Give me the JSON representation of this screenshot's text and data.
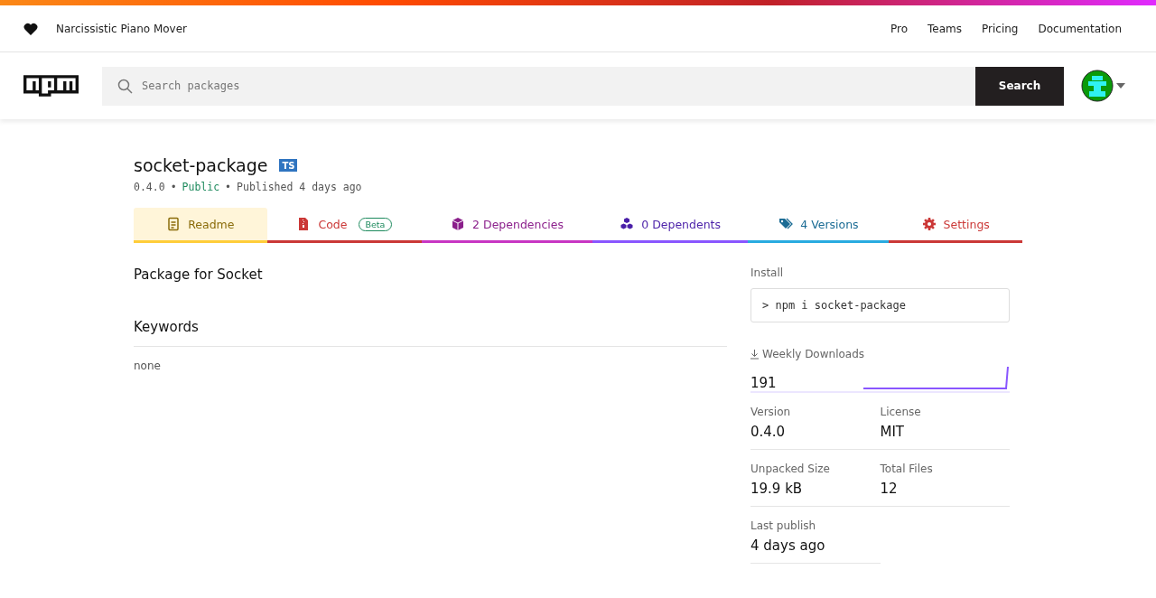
{
  "header": {
    "tagline": "Narcissistic Piano Mover",
    "links": [
      "Pro",
      "Teams",
      "Pricing",
      "Documentation"
    ]
  },
  "search": {
    "placeholder": "Search packages",
    "button": "Search"
  },
  "package": {
    "name": "socket-package",
    "ts_badge": "TS",
    "version": "0.4.0",
    "visibility": "Public",
    "published": "Published 4 days ago",
    "separator": "•"
  },
  "tabs": [
    {
      "kind": "readme",
      "label": "Readme",
      "selected": true,
      "color": "#8a6c0a"
    },
    {
      "kind": "code",
      "label": "Code",
      "badge": "Beta",
      "selected": false,
      "color": "#cb3837"
    },
    {
      "kind": "dependencies",
      "label": "2 Dependencies",
      "selected": false,
      "color": "#8b1f8b"
    },
    {
      "kind": "dependents",
      "label": "0 Dependents",
      "selected": false,
      "color": "#4a1fa8"
    },
    {
      "kind": "versions",
      "label": "4 Versions",
      "selected": false,
      "color": "#1a6b94"
    },
    {
      "kind": "settings",
      "label": "Settings",
      "selected": false,
      "color": "#cb3837"
    }
  ],
  "readme": {
    "description": "Package for Socket",
    "keywords_title": "Keywords",
    "keywords": "none"
  },
  "sidebar": {
    "install_label": "Install",
    "install_prompt": ">",
    "install_command": "npm i socket-package",
    "downloads_label": "Weekly Downloads",
    "downloads": "191",
    "stats": [
      {
        "label": "Version",
        "value": "0.4.0"
      },
      {
        "label": "License",
        "value": "MIT"
      },
      {
        "label": "Unpacked Size",
        "value": "19.9 kB"
      },
      {
        "label": "Total Files",
        "value": "12"
      },
      {
        "label": "Last publish",
        "value": "4 days ago"
      }
    ]
  }
}
